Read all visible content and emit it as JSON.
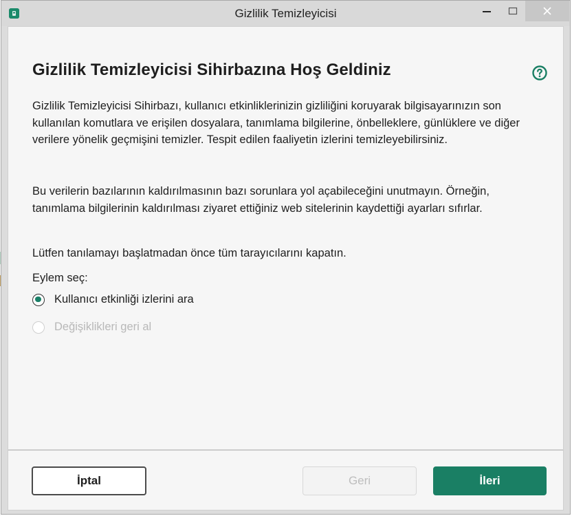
{
  "window": {
    "title": "Gizlilik Temizleyicisi"
  },
  "dialog": {
    "heading": "Gizlilik Temizleyicisi Sihirbazına Hoş Geldiniz",
    "paragraph1": "Gizlilik Temizleyicisi Sihirbazı, kullanıcı etkinliklerinizin gizliliğini koruyarak bilgisayarınızın son kullanılan komutlara ve erişilen dosyalara, tanımlama bilgilerine, önbelleklere, günlüklere ve diğer verilere yönelik geçmişini temizler. Tespit edilen faaliyetin izlerini temizleyebilirsiniz.",
    "paragraph2": "Bu verilerin bazılarının kaldırılmasının bazı sorunlara yol açabileceğini unutmayın. Örneğin, tanımlama bilgilerinin kaldırılması ziyaret ettiğiniz web sitelerinin kaydettiği ayarları sıfırlar.",
    "paragraph3": "Lütfen tanılamayı başlatmadan önce tüm tarayıcılarını kapatın.",
    "action_label": "Eylem seç:",
    "options": [
      {
        "label": "Kullanıcı etkinliği izlerini ara",
        "selected": true,
        "enabled": true
      },
      {
        "label": "Değişiklikleri geri al",
        "selected": false,
        "enabled": false
      }
    ]
  },
  "footer": {
    "cancel_label": "İptal",
    "back_label": "Geri",
    "next_label": "İleri"
  },
  "colors": {
    "accent": "#1a7f64",
    "disabled_text": "#b8b8b8"
  }
}
